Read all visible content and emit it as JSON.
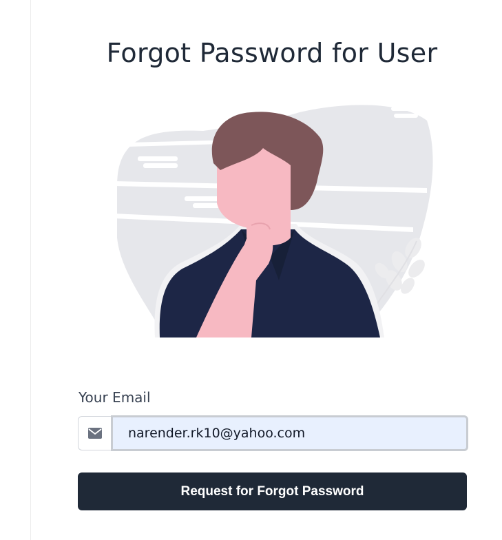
{
  "page": {
    "title": "Forgot Password for User"
  },
  "illustration": {
    "icon": "person-thinking-illustration",
    "colors": {
      "blob": "#e6e7eb",
      "hair": "#7d5659",
      "skin": "#f7b9c2",
      "shirt": "#1d2646",
      "leaves": "#ececee"
    }
  },
  "form": {
    "email_label": "Your Email",
    "email_icon": "envelope-icon",
    "email_value": "narender.rk10@yahoo.com",
    "submit_label": "Request for Forgot Password"
  },
  "colors": {
    "button_bg": "#1f2937",
    "input_autofill_bg": "#e8f0fe"
  }
}
